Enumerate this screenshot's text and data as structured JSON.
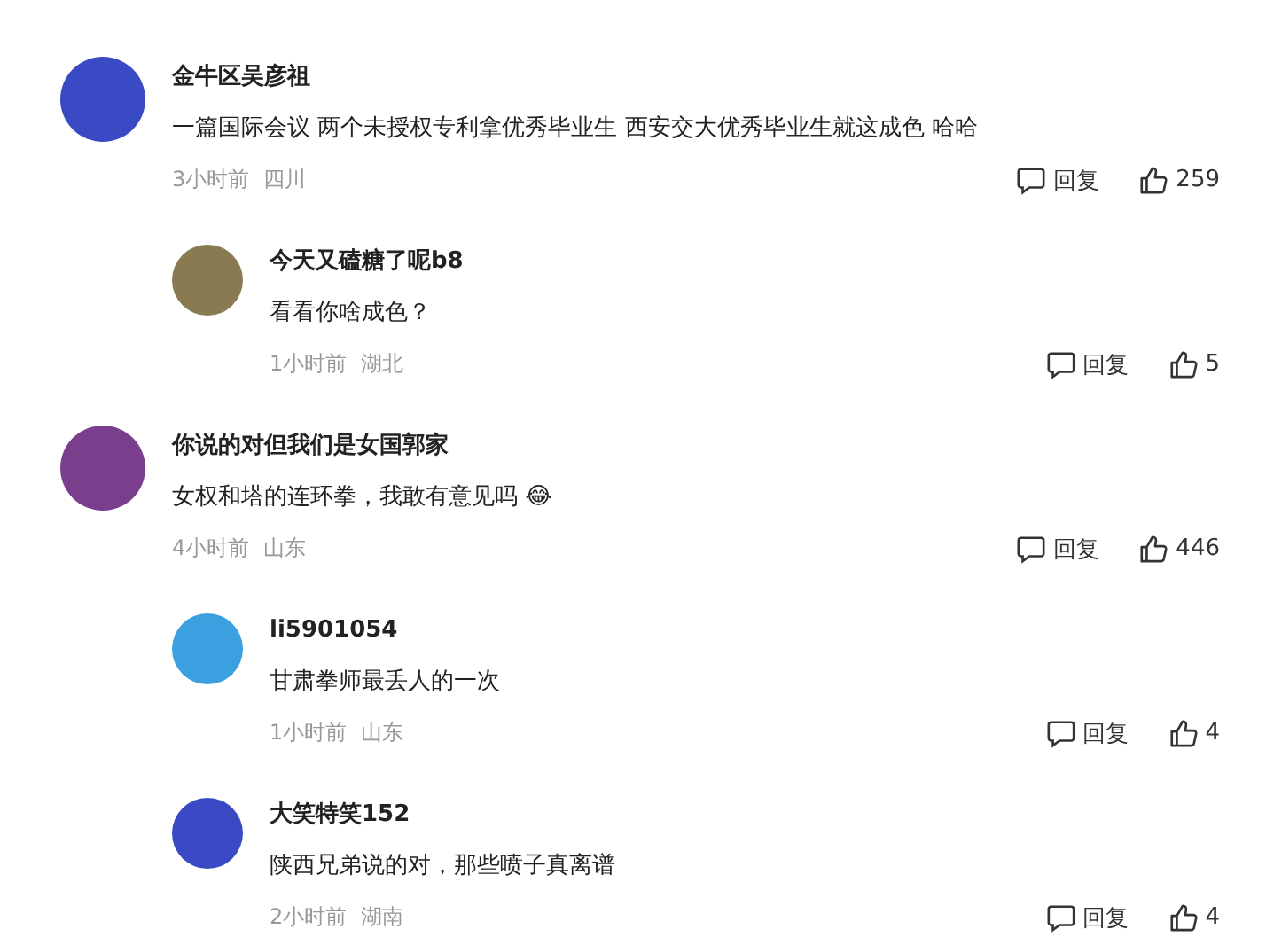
{
  "comments": [
    {
      "username": "金牛区吴彦祖",
      "content": "一篇国际会议 两个未授权专利拿优秀毕业生 西安交大优秀毕业生就这成色 哈哈",
      "time": "3小时前",
      "location": "四川",
      "reply_label": "回复",
      "likes": "259",
      "children": [
        {
          "username": "今天又磕糖了呢b8",
          "content": "看看你啥成色？",
          "time": "1小时前",
          "location": "湖北",
          "reply_label": "回复",
          "likes": "5"
        }
      ]
    },
    {
      "username": "你说的对但我们是女国郭家",
      "content": "女权和塔的连环拳，我敢有意见吗 😂",
      "time": "4小时前",
      "location": "山东",
      "reply_label": "回复",
      "likes": "446",
      "children": [
        {
          "username": "li5901054",
          "content": "甘肃拳师最丢人的一次",
          "time": "1小时前",
          "location": "山东",
          "reply_label": "回复",
          "likes": "4"
        },
        {
          "username": "大笑特笑152",
          "content": "陕西兄弟说的对，那些喷子真离谱",
          "time": "2小时前",
          "location": "湖南",
          "reply_label": "回复",
          "likes": "4"
        }
      ]
    }
  ]
}
